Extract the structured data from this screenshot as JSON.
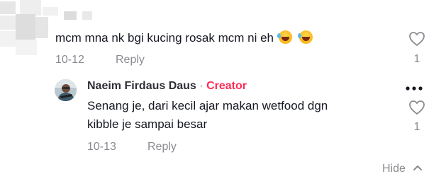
{
  "comment": {
    "text": "mcm mna nk bgi kucing rosak mcm ni eh",
    "emojis": [
      "rolling-on-floor-laughing",
      "rolling-on-floor-laughing"
    ],
    "date": "10-12",
    "reply_label": "Reply",
    "like_count": "1"
  },
  "reply": {
    "username": "Naeim Firdaus Daus",
    "separator": "·",
    "badge": "Creator",
    "text_line1": "Senang je, dari kecil ajar makan wetfood dgn",
    "text_line2": "kibble je sampai besar",
    "date": "10-13",
    "reply_label": "Reply",
    "like_count": "1"
  },
  "footer": {
    "hide_label": "Hide"
  },
  "colors": {
    "creator_badge": "#fe2c55",
    "muted": "#8a8b91",
    "text": "#161823"
  }
}
